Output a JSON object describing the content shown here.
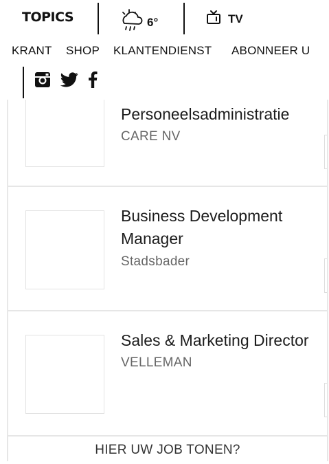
{
  "header": {
    "logo": "TOPICS",
    "weather": {
      "temperature": "6°",
      "icon": "cloud-rain-sun-icon"
    },
    "tv": {
      "label": "TV",
      "icon": "tv-icon"
    }
  },
  "nav": {
    "items": [
      {
        "label": "KRANT"
      },
      {
        "label": "SHOP"
      },
      {
        "label": "KLANTENDIENST"
      },
      {
        "label": "ABONNEER U"
      }
    ]
  },
  "social": {
    "icons": [
      "instagram-icon",
      "twitter-icon",
      "facebook-icon"
    ]
  },
  "jobs": [
    {
      "title_lines": [
        "Personeelsadministratie"
      ],
      "company": "CARE NV"
    },
    {
      "title_lines": [
        "Business Development",
        "Manager"
      ],
      "company": "Stadsbader"
    },
    {
      "title_lines": [
        "Sales & Marketing Director"
      ],
      "company": "VELLEMAN"
    }
  ],
  "cta": {
    "label": "HIER UW JOB TONEN?"
  }
}
